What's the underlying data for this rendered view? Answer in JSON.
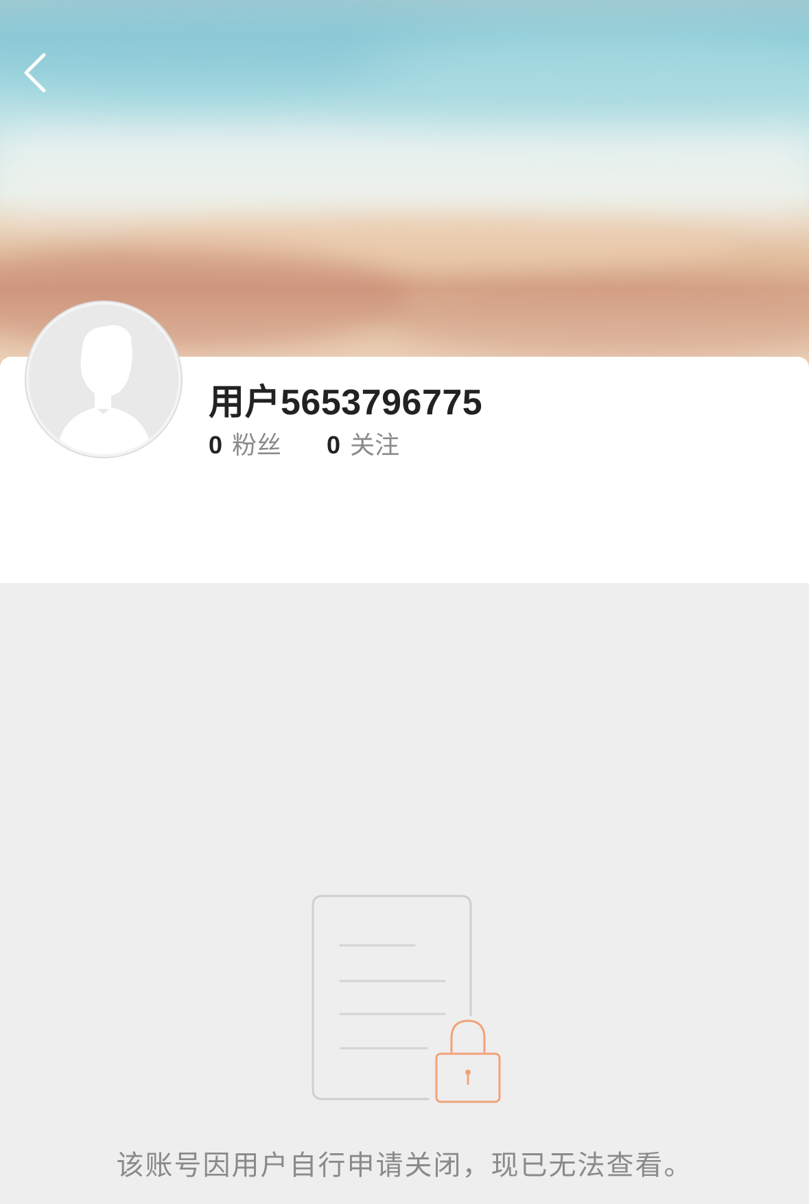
{
  "header": {
    "back_icon": "chevron-left-icon",
    "banner": "beach-sand-background"
  },
  "profile": {
    "avatar_icon": "default-avatar-icon",
    "username": "用户5653796775",
    "stats": [
      {
        "value": "0",
        "label": "粉丝"
      },
      {
        "value": "0",
        "label": "关注"
      }
    ]
  },
  "empty_state": {
    "icon": "locked-document-icon",
    "message": "该账号因用户自行申请关闭，现已无法查看。",
    "colors": {
      "document_outline": "#cfcfcf",
      "lock": "#f2a27a"
    }
  }
}
